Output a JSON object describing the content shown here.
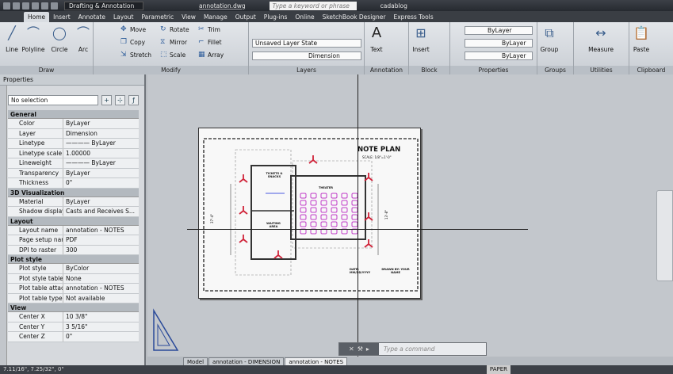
{
  "titlebar": {
    "workspace": "Drafting & Annotation",
    "filename": "annotation.dwg",
    "search_placeholder": "Type a keyword or phrase",
    "user": "cadablog"
  },
  "ribbon": {
    "tabs": [
      "Home",
      "Insert",
      "Annotate",
      "Layout",
      "Parametric",
      "View",
      "Manage",
      "Output",
      "Plug-ins",
      "Online",
      "SketchBook Designer",
      "Express Tools"
    ],
    "active_tab": "Home",
    "draw": {
      "title": "Draw",
      "line": "Line",
      "polyline": "Polyline",
      "circle": "Circle",
      "arc": "Arc"
    },
    "modify": {
      "title": "Modify",
      "move": "Move",
      "rotate": "Rotate",
      "trim": "Trim",
      "copy": "Copy",
      "mirror": "Mirror",
      "fillet": "Fillet",
      "stretch": "Stretch",
      "scale": "Scale",
      "array": "Array"
    },
    "layers": {
      "title": "Layers",
      "state": "Unsaved Layer State",
      "current": "Dimension"
    },
    "annotation": {
      "title": "Annotation",
      "text": "Text"
    },
    "block": {
      "title": "Block",
      "insert": "Insert"
    },
    "properties": {
      "title": "Properties",
      "color": "ByLayer",
      "linetype": "ByLayer",
      "lineweight": "ByLayer"
    },
    "groups": {
      "title": "Groups",
      "group": "Group"
    },
    "utilities": {
      "title": "Utilities",
      "measure": "Measure"
    },
    "clipboard": {
      "title": "Clipboard",
      "paste": "Paste"
    }
  },
  "properties_palette": {
    "title": "Properties",
    "selection": "No selection",
    "sections": [
      {
        "name": "General",
        "rows": [
          [
            "Color",
            "ByLayer"
          ],
          [
            "Layer",
            "Dimension"
          ],
          [
            "Linetype",
            "———— ByLayer"
          ],
          [
            "Linetype scale",
            "1.00000"
          ],
          [
            "Lineweight",
            "———— ByLayer"
          ],
          [
            "Transparency",
            "ByLayer"
          ],
          [
            "Thickness",
            "0\""
          ]
        ]
      },
      {
        "name": "3D Visualization",
        "rows": [
          [
            "Material",
            "ByLayer"
          ],
          [
            "Shadow display",
            "Casts and Receives S..."
          ]
        ]
      },
      {
        "name": "Layout",
        "rows": [
          [
            "Layout name",
            "annotation - NOTES"
          ],
          [
            "Page setup name",
            "PDF"
          ],
          [
            "DPI to raster",
            "300"
          ]
        ]
      },
      {
        "name": "Plot style",
        "rows": [
          [
            "Plot style",
            "ByColor"
          ],
          [
            "Plot style table",
            "None"
          ],
          [
            "Plot table attach...",
            "annotation - NOTES"
          ],
          [
            "Plot table type",
            "Not available"
          ]
        ]
      },
      {
        "name": "View",
        "rows": [
          [
            "Center X",
            "10 3/8\""
          ],
          [
            "Center Y",
            "3 5/16\""
          ],
          [
            "Center Z",
            "0\""
          ]
        ]
      }
    ]
  },
  "drawing": {
    "title": "NOTE PLAN",
    "scale": "SCALE: 1/8\"=1'-0\"",
    "tickets": "TICKETS & SNACKS",
    "theater": "THEATER",
    "waiting": "WAITING AREA",
    "date": "DATE: MM/DD/YYYY",
    "drawn_by": "DRAWN BY: YOUR NAME",
    "seat_color": "#c03cc8",
    "chair_color": "#d0243a"
  },
  "command": {
    "placeholder": "Type a command"
  },
  "layout_tabs": [
    "Model",
    "annotation - DIMENSION",
    "annotation - NOTES"
  ],
  "active_layout": "annotation - NOTES",
  "status": {
    "coords": "7.11/16\", 7.25/32\", 0\"",
    "paper": "PAPER"
  }
}
